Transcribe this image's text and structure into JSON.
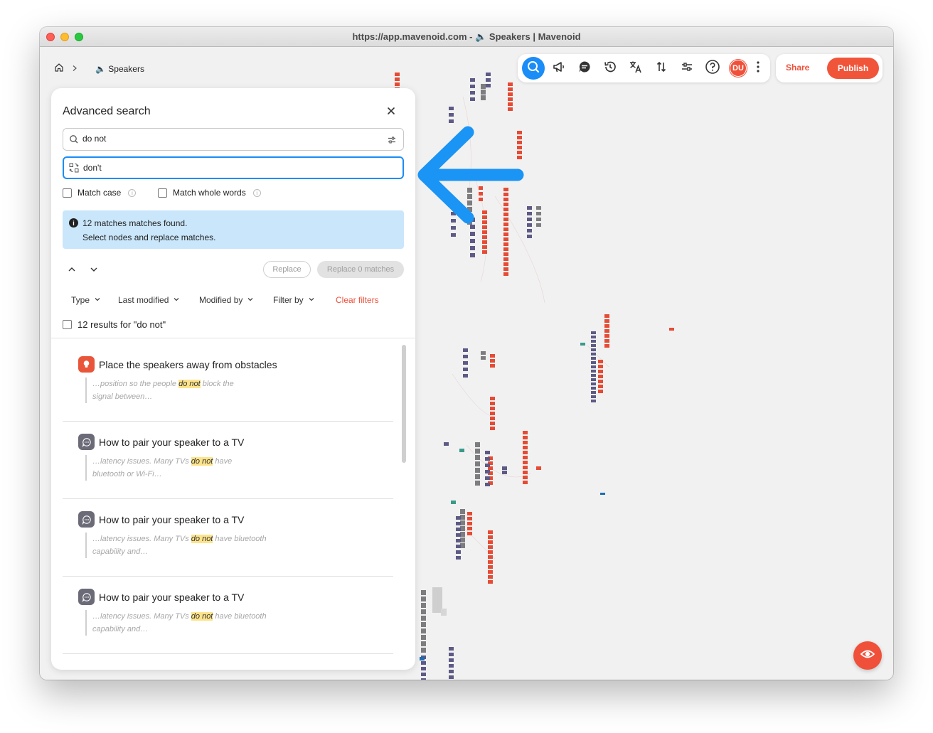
{
  "window": {
    "title": "https://app.mavenoid.com - 🔈 Speakers | Mavenoid"
  },
  "breadcrumb": {
    "home_icon": "home-icon",
    "current": "🔈 Speakers"
  },
  "toolbar": {
    "icons": [
      "search-icon",
      "megaphone-icon",
      "chat-icon",
      "history-icon",
      "translate-icon",
      "sort-icon",
      "sliders-icon",
      "help-icon"
    ],
    "avatar": "DU",
    "share_label": "Share",
    "publish_label": "Publish"
  },
  "search_panel": {
    "title": "Advanced search",
    "search_value": "do not",
    "replace_value": "don't",
    "match_case_label": "Match case",
    "match_whole_words_label": "Match whole words",
    "notice_line1": "12 matches matches found.",
    "notice_line2": "Select nodes and replace matches.",
    "replace_label": "Replace",
    "replace_all_label": "Replace 0 matches",
    "filters": {
      "type": "Type",
      "last_modified": "Last modified",
      "modified_by": "Modified by",
      "filter_by": "Filter by"
    },
    "clear_filters_label": "Clear filters",
    "results_label": "12 results for \"do not\"",
    "results": [
      {
        "icon": "lightbulb-icon",
        "icon_color": "#e8553a",
        "title": "Place the speakers away from obstacles",
        "pre": "…position so the people ",
        "match": "do not",
        "post1": " block the",
        "line2": "signal between…"
      },
      {
        "icon": "chat-bubble-icon",
        "icon_color": "#6b6b78",
        "title": "How to pair your speaker to a TV",
        "pre": "…latency issues. Many TVs ",
        "match": "do not",
        "post1": " have",
        "line2": "bluetooth or Wi-Fi…"
      },
      {
        "icon": "chat-bubble-icon",
        "icon_color": "#6b6b78",
        "title": "How to pair your speaker to a TV",
        "pre": "…latency issues. Many TVs ",
        "match": "do not",
        "post1": " have bluetooth",
        "line2": "capability and…"
      },
      {
        "icon": "chat-bubble-icon",
        "icon_color": "#6b6b78",
        "title": "How to pair your speaker to a TV",
        "pre": "…latency issues. Many TVs ",
        "match": "do not",
        "post1": " have bluetooth",
        "line2": "capability and…"
      }
    ]
  },
  "annotation": {
    "arrow_color": "#1a94f5"
  },
  "colors": {
    "accent": "#f0503a",
    "primary_blue": "#1a8df7",
    "node_red": "#e54b35",
    "node_purple": "#5d5a86",
    "node_gray": "#7d7d80"
  },
  "floating": {
    "eye_icon": "eye-icon"
  }
}
